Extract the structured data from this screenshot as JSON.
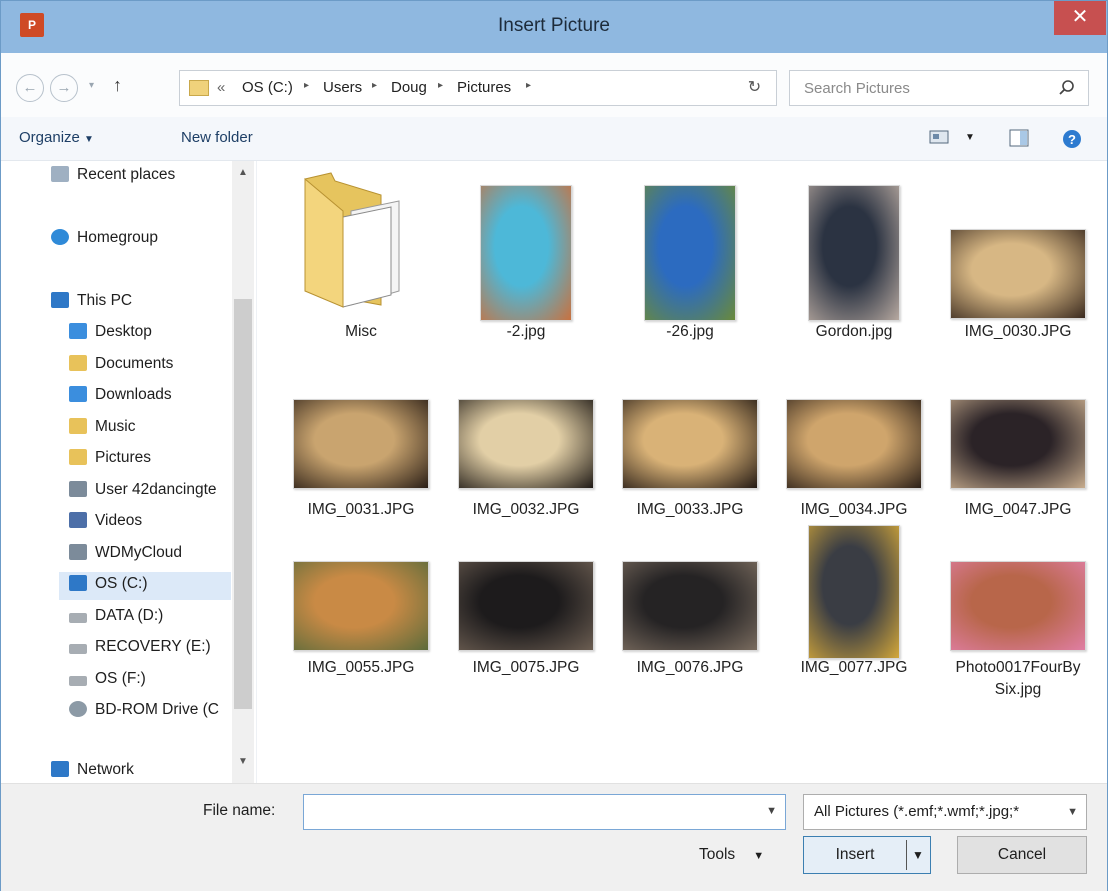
{
  "window": {
    "title": "Insert Picture",
    "app_icon": "P"
  },
  "nav": {
    "back_icon": "back-arrow-icon",
    "forward_icon": "forward-arrow-icon",
    "breadcrumb": [
      "OS (C:)",
      "Users",
      "Doug",
      "Pictures"
    ],
    "overflow": "«",
    "search_placeholder": "Search Pictures"
  },
  "toolbar": {
    "organize": "Organize",
    "new_folder": "New folder"
  },
  "sidebar": {
    "items": [
      {
        "label": "Recent places",
        "icon": "recent-places-icon",
        "color": "#9fb0c2"
      },
      {
        "label": "Homegroup",
        "icon": "homegroup-icon",
        "color": "#2f8ad8"
      },
      {
        "label": "This PC",
        "icon": "computer-icon",
        "color": "#2e78c7"
      },
      {
        "label": "Desktop",
        "icon": "desktop-folder-icon",
        "color": "#3b8ede"
      },
      {
        "label": "Documents",
        "icon": "documents-folder-icon",
        "color": "#e8c25a"
      },
      {
        "label": "Downloads",
        "icon": "downloads-folder-icon",
        "color": "#3b8ede"
      },
      {
        "label": "Music",
        "icon": "music-folder-icon",
        "color": "#e8c25a"
      },
      {
        "label": "Pictures",
        "icon": "pictures-folder-icon",
        "color": "#e8c25a"
      },
      {
        "label": "User 42dancingte",
        "icon": "network-drive-icon",
        "color": "#7c8b9a"
      },
      {
        "label": "Videos",
        "icon": "videos-folder-icon",
        "color": "#4d6fa8"
      },
      {
        "label": "WDMyCloud",
        "icon": "network-drive-icon",
        "color": "#7c8b9a"
      },
      {
        "label": "OS (C:)",
        "icon": "system-drive-icon",
        "color": "#2e78c7"
      },
      {
        "label": "DATA (D:)",
        "icon": "drive-icon",
        "color": "#a7adb3"
      },
      {
        "label": "RECOVERY (E:)",
        "icon": "drive-icon",
        "color": "#a7adb3"
      },
      {
        "label": "OS (F:)",
        "icon": "drive-icon",
        "color": "#a7adb3"
      },
      {
        "label": "BD-ROM Drive (C",
        "icon": "optical-drive-icon",
        "color": "#8c9aa6"
      },
      {
        "label": "Network",
        "icon": "network-icon",
        "color": "#2e78c7"
      }
    ]
  },
  "files": [
    {
      "name": "Misc",
      "kind": "folder"
    },
    {
      "name": "-2.jpg",
      "kind": "portrait",
      "c1": "#4db8d8",
      "c2": "#c9713f"
    },
    {
      "name": "-26.jpg",
      "kind": "portrait",
      "c1": "#2c6bc0",
      "c2": "#6a8a3a"
    },
    {
      "name": "Gordon.jpg",
      "kind": "portrait",
      "c1": "#2b3342",
      "c2": "#b7a9a0"
    },
    {
      "name": "IMG_0030.JPG",
      "kind": "landscape",
      "c1": "#d7b784",
      "c2": "#3a2a1f"
    },
    {
      "name": "IMG_0031.JPG",
      "kind": "landscape",
      "c1": "#c9a46f",
      "c2": "#2a1e16"
    },
    {
      "name": "IMG_0032.JPG",
      "kind": "landscape",
      "c1": "#e2cfa6",
      "c2": "#1f1a16"
    },
    {
      "name": "IMG_0033.JPG",
      "kind": "landscape",
      "c1": "#d9b277",
      "c2": "#241a14"
    },
    {
      "name": "IMG_0034.JPG",
      "kind": "landscape",
      "c1": "#cfa56c",
      "c2": "#2c2018"
    },
    {
      "name": "IMG_0047.JPG",
      "kind": "landscape",
      "c1": "#2b2327",
      "c2": "#c8ad8e"
    },
    {
      "name": "IMG_0055.JPG",
      "kind": "landscape",
      "c1": "#c98a45",
      "c2": "#5c6b3b"
    },
    {
      "name": "IMG_0075.JPG",
      "kind": "landscape",
      "c1": "#1d1b1c",
      "c2": "#6c5e52"
    },
    {
      "name": "IMG_0076.JPG",
      "kind": "landscape",
      "c1": "#252324",
      "c2": "#7a6c5f"
    },
    {
      "name": "IMG_0077.JPG",
      "kind": "tall",
      "c1": "#3a3d44",
      "c2": "#d4a83a"
    },
    {
      "name": "Photo0017FourBySix.jpg",
      "kind": "landscape",
      "c1": "#b8664a",
      "c2": "#e07ea4",
      "cap_lines": [
        "Photo0017FourBy",
        "Six.jpg"
      ]
    }
  ],
  "footer": {
    "file_name_label": "File name:",
    "file_name_value": "",
    "filter": "All Pictures (*.emf;*.wmf;*.jpg;*",
    "tools": "Tools",
    "insert": "Insert",
    "cancel": "Cancel"
  },
  "colors": {
    "titlebar": "#8fb8e0",
    "close": "#c75050",
    "accent": "#3c7fb1"
  }
}
